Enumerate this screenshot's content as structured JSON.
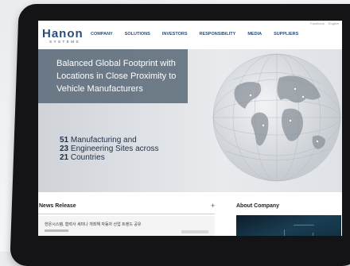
{
  "header": {
    "utility_links": [
      "Facebook",
      "English"
    ],
    "logo_main": "Hanon",
    "logo_sub": "SYSTEMS",
    "nav": [
      "COMPANY",
      "SOLUTIONS",
      "INVESTORS",
      "RESPONSIBILITY",
      "MEDIA",
      "SUPPLIERS"
    ]
  },
  "hero": {
    "title": "Balanced Global Footprint with Locations in Close Proximity to Vehicle Manufacturers",
    "stats": [
      {
        "num": "51",
        "text": " Manufacturing and"
      },
      {
        "num": "23",
        "text": " Engineering Sites across"
      },
      {
        "num": "21",
        "text": " Countries"
      }
    ],
    "slides": 3,
    "active_slide": 1,
    "accent_color": "#e5491f"
  },
  "news": {
    "title": "News Release",
    "more": "+",
    "item_text": "한온시스템, 협력사 세미나 개최해 자동차 산업 트렌드 공유"
  },
  "about": {
    "title": "About Company"
  },
  "colors": {
    "brand": "#2a4d7a",
    "hero_box": "#5c6c7a"
  }
}
